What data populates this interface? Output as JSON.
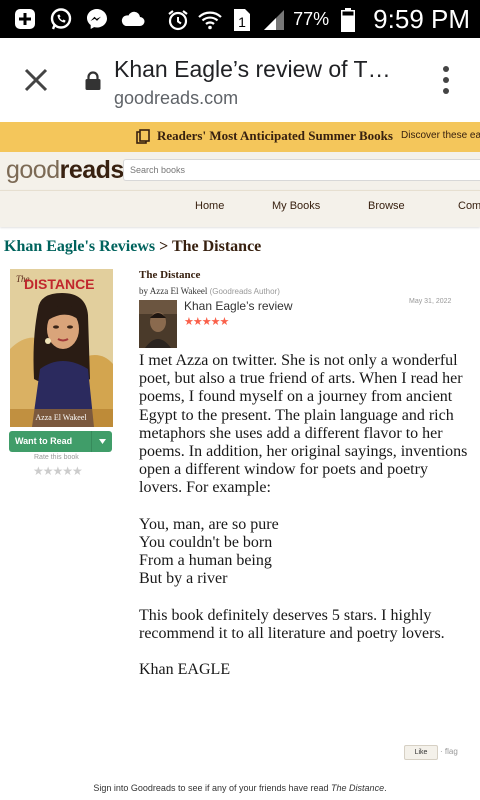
{
  "status_bar": {
    "battery_percent": "77%",
    "time": "9:59 PM",
    "sim_slot": "1",
    "icons": [
      "plus-box-icon",
      "whatsapp-icon",
      "messenger-icon",
      "cloud-icon",
      "alarm-icon",
      "wifi-icon",
      "sim-icon",
      "signal-icon",
      "battery-icon"
    ]
  },
  "browser": {
    "page_title": "Khan Eagle’s review of T…",
    "domain": "goodreads.com",
    "icons": [
      "close-icon",
      "lock-icon",
      "more-vert-icon"
    ]
  },
  "banner": {
    "title": "Readers' Most Anticipated Summer Books",
    "subtitle": "Discover these ea"
  },
  "header": {
    "logo_light": "good",
    "logo_bold": "reads",
    "search_placeholder": "Search books"
  },
  "nav": {
    "items": [
      "Home",
      "My Books",
      "Browse",
      "Com"
    ]
  },
  "breadcrumb": {
    "reviews_link": "Khan Eagle's Reviews",
    "separator": " > ",
    "book": "The Distance"
  },
  "cover": {
    "title_the": "The",
    "title": "DISTANCE",
    "author": "Azza El Wakeel"
  },
  "shelf": {
    "want_to_read": "Want to Read",
    "rate_label": "Rate this book",
    "rating_stars": "★★★★★"
  },
  "review": {
    "book_title": "The Distance",
    "by": "by",
    "author": "Azza El Wakeel",
    "author_badge": "(Goodreads Author)",
    "reviewer_line": "Khan Eagle’s review",
    "date": "May 31, 2022",
    "stars": "★★★★★",
    "rating": 5,
    "paragraph1": "I met Azza on twitter. She is not only a wonderful poet, but also a true friend of arts. When I read her poems, I found myself on a journey from ancient Egypt to the present. The plain language and rich metaphors she uses add a different flavor to her poems. In addition, her original sayings, inventions open a different window for poets and poetry lovers. For example:",
    "poem": [
      "You, man, are so pure",
      "You couldn't be born",
      "From a human being",
      "But by a river"
    ],
    "paragraph2": "This book definitely deserves 5 stars. I highly recommend it to all literature and poetry lovers.",
    "signature": "Khan EAGLE",
    "like_label": "Like",
    "flag_label": "· flag"
  },
  "footer": {
    "signin_prefix": "Sign into Goodreads to see if any of your friends have read ",
    "signin_book": "The Distance",
    "signin_suffix": "."
  },
  "colors": {
    "banner_bg": "#f4c65b",
    "header_bg": "#f4f1ea",
    "link_teal": "#00635d",
    "brown": "#382110",
    "want_green": "#409d69",
    "review_star": "#fa604a"
  }
}
